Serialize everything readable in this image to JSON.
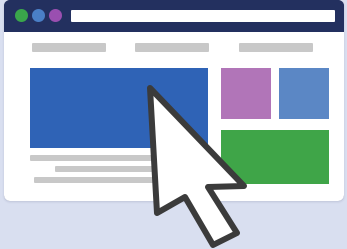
{
  "colors": {
    "background": "#d9dff0",
    "window_frame": "#23305f",
    "address_bar": "#ffffff",
    "content_background": "#ffffff",
    "placeholder_gray": "#c8c8c8",
    "dot_green": "#3aa64b",
    "dot_blue": "#4a7fc6",
    "dot_purple": "#9a4fb0",
    "hero_blue": "#2f63b6",
    "tile_purple": "#b175b8",
    "tile_blue": "#5b87c5",
    "tile_green": "#3fa548",
    "cursor_fill": "#ffffff",
    "cursor_outline": "#3b3b3b"
  },
  "icons": {
    "window_dots": [
      "green-dot-icon",
      "blue-dot-icon",
      "purple-dot-icon"
    ],
    "pointer": "mouse-pointer-icon"
  }
}
